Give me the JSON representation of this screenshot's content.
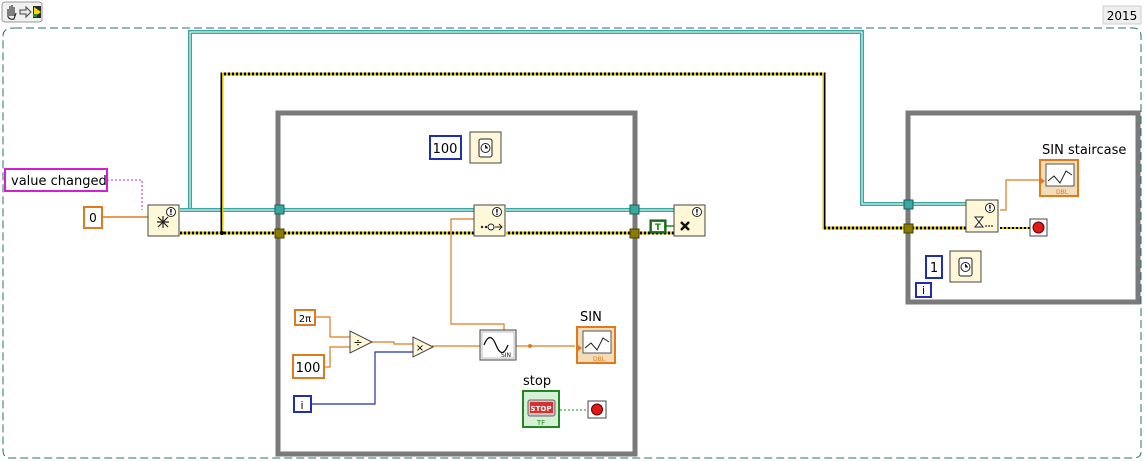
{
  "version_label": "2015",
  "toolbar": {
    "hand_tool": "hand-tool-icon",
    "arrow_tool": "arrow-icon",
    "run_tool": "run-arrow-icon"
  },
  "controls": {
    "value_changed": "value changed",
    "zero_constant": "0",
    "wait_ms_main": "100",
    "two_pi": "2π",
    "divisor_100": "100",
    "iteration_main": "i",
    "true_constant": "T",
    "wait_ms_right": "1",
    "iteration_right": "i"
  },
  "indicators": {
    "sin": "SIN",
    "stop": "stop",
    "sin_staircase": "SIN staircase",
    "stop_button_text": "STOP",
    "tf_label": "TF",
    "dbl_label": "DBL",
    "sin_node_label": "SIN"
  },
  "colors": {
    "orange_wire": "#e07a1e",
    "blue_wire": "#1f2fb0",
    "magenta_wire": "#d020d0",
    "teal_wire": "#3aa7a0",
    "error_wire": "#8a7a00",
    "loop_border": "#808080",
    "node_fill": "#fff8d8",
    "green_bool": "#208820"
  }
}
